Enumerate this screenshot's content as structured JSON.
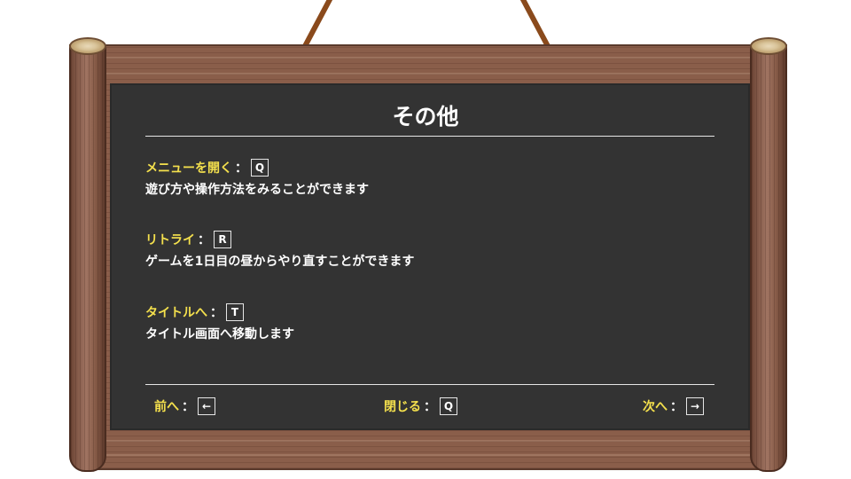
{
  "title": "その他",
  "entries": [
    {
      "command": "メニューを開く",
      "key": "Q",
      "description": "遊び方や操作方法をみることができます"
    },
    {
      "command": "リトライ",
      "key": "R",
      "description": "ゲームを1日目の昼からやり直すことができます"
    },
    {
      "command": "タイトルへ",
      "key": "T",
      "description": "タイトル画面へ移動します"
    }
  ],
  "colon": "：",
  "nav": {
    "prev": {
      "label": "前へ",
      "key": "←"
    },
    "close": {
      "label": "閉じる",
      "key": "Q"
    },
    "next": {
      "label": "次へ",
      "key": "→"
    }
  },
  "colors": {
    "board": "#333333",
    "command_text": "#f4e04d",
    "text": "#ffffff",
    "wood": "#8a5e4a",
    "rope": "#8a4a1c"
  }
}
